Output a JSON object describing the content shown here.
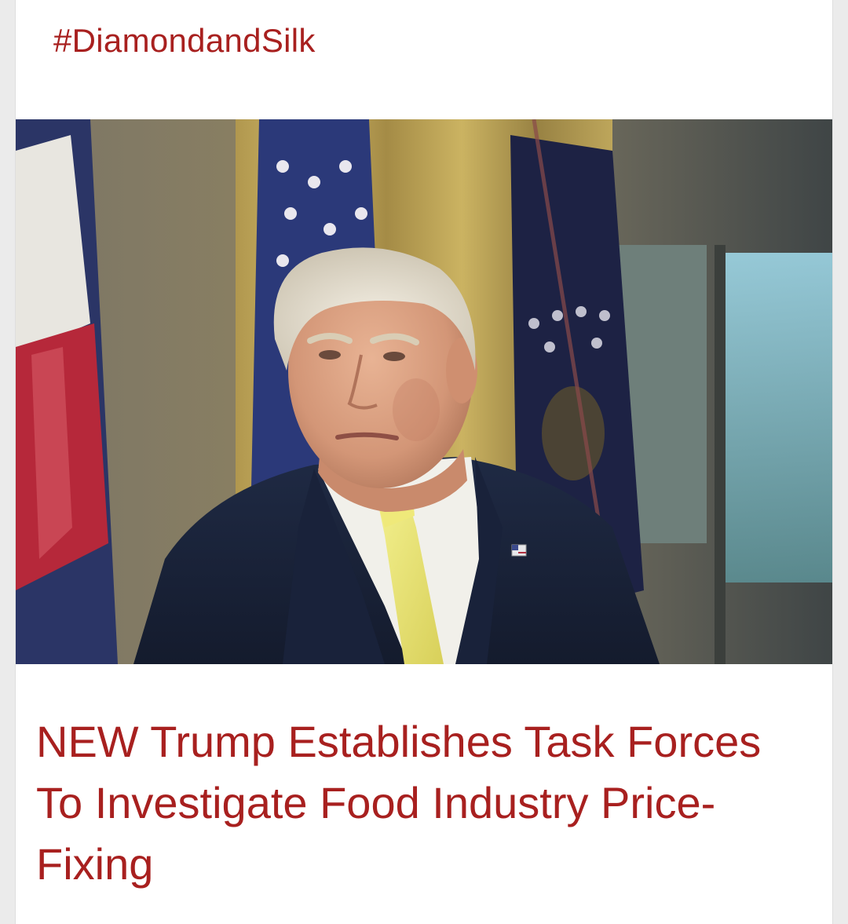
{
  "post": {
    "hashtag": "#DiamondandSilk",
    "headline": "NEW Trump Establishes Task Forces To Investigate Food Industry Price-Fixing"
  },
  "colors": {
    "accent": "#a8201f",
    "card_background": "#ffffff",
    "page_background": "#ebebeb"
  },
  "image": {
    "subject": "portrait of a white-haired man in a navy suit, white shirt and yellow tie with a flag lapel pin, in front of flags and gold curtains"
  }
}
